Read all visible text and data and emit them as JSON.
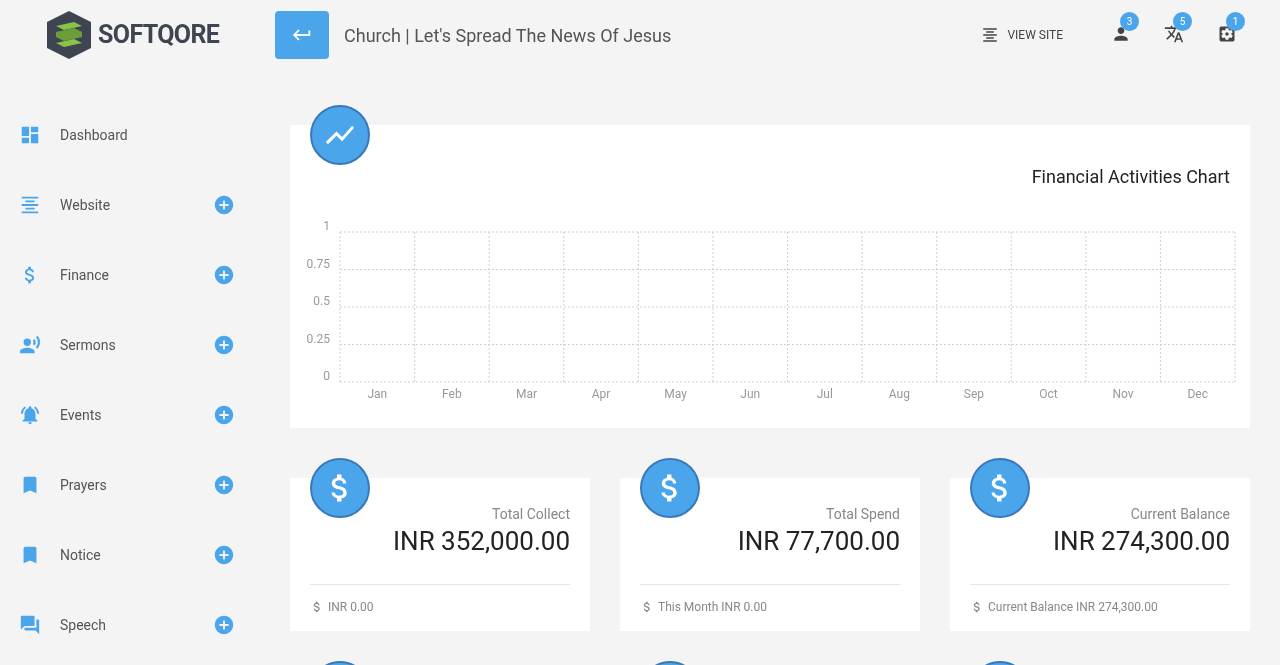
{
  "logo": {
    "text": "SOFTQORE"
  },
  "header": {
    "title": "Church | Let's Spread The News Of Jesus",
    "view_site": "VIEW SITE",
    "badges": [
      {
        "kind": "user",
        "count": "3"
      },
      {
        "kind": "translate",
        "count": "5"
      },
      {
        "kind": "settings",
        "count": "1"
      }
    ]
  },
  "sidebar": {
    "items": [
      {
        "label": "Dashboard",
        "kind": "dashboard"
      },
      {
        "label": "Website",
        "kind": "website"
      },
      {
        "label": "Finance",
        "kind": "finance"
      },
      {
        "label": "Sermons",
        "kind": "sermons"
      },
      {
        "label": "Events",
        "kind": "events"
      },
      {
        "label": "Prayers",
        "kind": "prayers"
      },
      {
        "label": "Notice",
        "kind": "notice"
      },
      {
        "label": "Speech",
        "kind": "speech"
      }
    ]
  },
  "chart_card": {
    "chart_data": {
      "type": "line",
      "title": "Financial Activities Chart",
      "categories": [
        "Jan",
        "Feb",
        "Mar",
        "Apr",
        "May",
        "Jun",
        "Jul",
        "Aug",
        "Sep",
        "Oct",
        "Nov",
        "Dec"
      ],
      "grid": true,
      "ylim": [
        0,
        1
      ],
      "yticks": [
        0,
        0.25,
        0.5,
        0.75,
        1
      ]
    }
  },
  "stats": [
    {
      "label": "Total Collect",
      "value": "INR 352,000.00",
      "footer": "INR 0.00"
    },
    {
      "label": "Total Spend",
      "value": "INR 77,700.00",
      "footer": "This Month INR 0.00"
    },
    {
      "label": "Current Balance",
      "value": "INR 274,300.00",
      "footer": "Current Balance INR 274,300.00"
    }
  ]
}
